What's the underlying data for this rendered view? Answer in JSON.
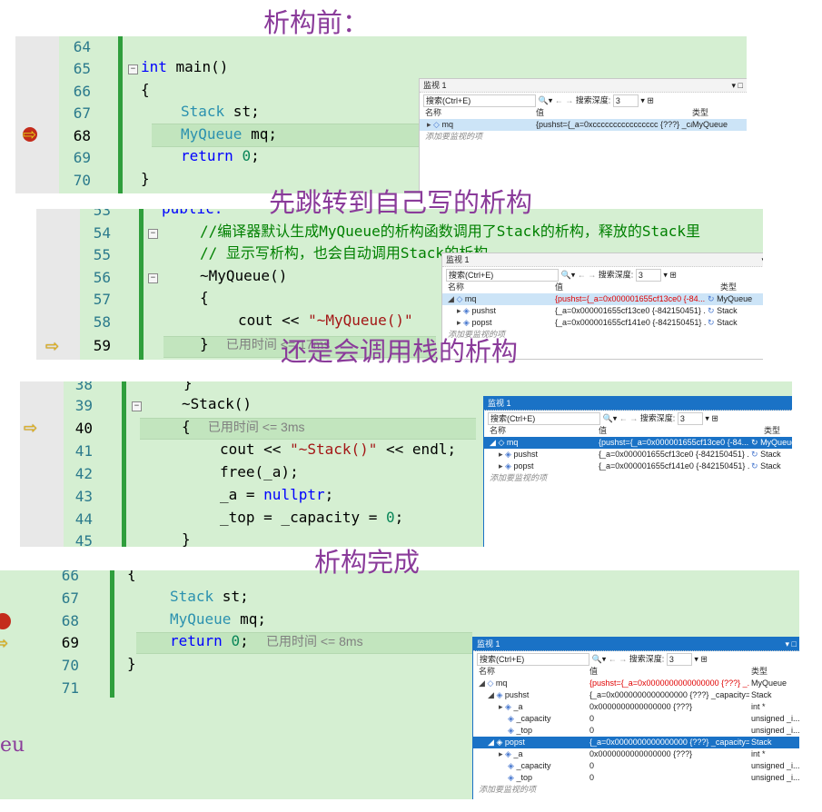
{
  "headings": [
    "析构前：",
    "先跳转到自己写的析构",
    "还是会调用栈的析构",
    "析构完成"
  ],
  "panel1": {
    "lines": [
      "64",
      "65",
      "66",
      "67",
      "68",
      "69",
      "70"
    ],
    "code": {
      "l65_kw": "int",
      "l65_rest": " main()",
      "l66": "{",
      "l67_type": "Stack",
      "l67_rest": " st;",
      "l68_type": "MyQueue",
      "l68_rest": " mq;",
      "l69_kw": "return",
      "l69_num": "0",
      "l69_rest": ";",
      "l70": "}"
    }
  },
  "panel2": {
    "lines": [
      "53",
      "54",
      "55",
      "56",
      "57",
      "58",
      "59"
    ],
    "code": {
      "l53": "public:",
      "l54": "//编译器默认生成MyQueue的析构函数调用了Stack的析构，释放的Stack里",
      "l55": "// 显示写析构，也会自动调用Stack的析构",
      "l56": "~MyQueue()",
      "l57": "{",
      "l58_a": "cout << ",
      "l58_str": "\"~MyQueue()\"",
      "l59": "}",
      "elapsed": "已用时间 <= 17ms"
    }
  },
  "panel3": {
    "lines": [
      "38",
      "39",
      "40",
      "41",
      "42",
      "43",
      "44",
      "45"
    ],
    "code": {
      "l38": "}",
      "l39": "~Stack()",
      "l40": "{",
      "elapsed": "已用时间 <= 3ms",
      "l41_a": "cout << ",
      "l41_str": "\"~Stack()\"",
      "l41_b": " << endl;",
      "l42": "free(_a);",
      "l43_a": "_a = ",
      "l43_kw": "nullptr",
      "l43_b": ";",
      "l44_a": "_top = _capacity = ",
      "l44_num": "0",
      "l44_b": ";",
      "l45": "}"
    }
  },
  "panel4": {
    "lines": [
      "66",
      "67",
      "68",
      "69",
      "70",
      "71"
    ],
    "code": {
      "l66": "{",
      "l67_type": "Stack",
      "l67_rest": " st;",
      "l68_type": "MyQueue",
      "l68_rest": " mq;",
      "l69_kw": "return",
      "l69_num": "0",
      "l69_rest": ";",
      "elapsed": "已用时间 <= 8ms",
      "l70": "}"
    },
    "stray": "eu"
  },
  "watch_common": {
    "title": "监视 1",
    "search_placeholder": "搜索(Ctrl+E)",
    "depth_label": "搜索深度:",
    "depth_value": "3",
    "col_name": "名称",
    "col_value": "值",
    "col_type": "类型",
    "add_hint": "添加要监视的项"
  },
  "watch1": {
    "rows": [
      {
        "name": "mq",
        "value": "{pushst={_a=0xcccccccccccccccc {???} _cap...",
        "type": "MyQueue"
      }
    ]
  },
  "watch2": {
    "rows": [
      {
        "name": "mq",
        "value": "{pushst={_a=0x000001655cf13ce0 {-84...",
        "type": "MyQueue"
      },
      {
        "name": "pushst",
        "value": "{_a=0x000001655cf13ce0 {-842150451} ...",
        "type": "Stack"
      },
      {
        "name": "popst",
        "value": "{_a=0x000001655cf141e0 {-842150451} ...",
        "type": "Stack"
      }
    ]
  },
  "watch3": {
    "rows": [
      {
        "name": "mq",
        "value": "{pushst={_a=0x000001655cf13ce0 {-84...",
        "type": "MyQueue"
      },
      {
        "name": "pushst",
        "value": "{_a=0x000001655cf13ce0 {-842150451} ...",
        "type": "Stack"
      },
      {
        "name": "popst",
        "value": "{_a=0x000001655cf141e0 {-842150451} ...",
        "type": "Stack"
      }
    ]
  },
  "watch4": {
    "rows": [
      {
        "name": "mq",
        "value": "{pushst={_a=0x0000000000000000 {???} _...",
        "type": "MyQueue"
      },
      {
        "name": "pushst",
        "value": "{_a=0x0000000000000000 {???} _capacity=...",
        "type": "Stack"
      },
      {
        "name": "_a",
        "value": "0x0000000000000000 {???}",
        "type": "int *"
      },
      {
        "name": "_capacity",
        "value": "0",
        "type": "unsigned _i..."
      },
      {
        "name": "_top",
        "value": "0",
        "type": "unsigned _i..."
      },
      {
        "name": "popst",
        "value": "{_a=0x0000000000000000 {???} _capacity=...",
        "type": "Stack"
      },
      {
        "name": "_a",
        "value": "0x0000000000000000 {???}",
        "type": "int *"
      },
      {
        "name": "_capacity",
        "value": "0",
        "type": "unsigned _i..."
      },
      {
        "name": "_top",
        "value": "0",
        "type": "unsigned _i..."
      }
    ]
  }
}
